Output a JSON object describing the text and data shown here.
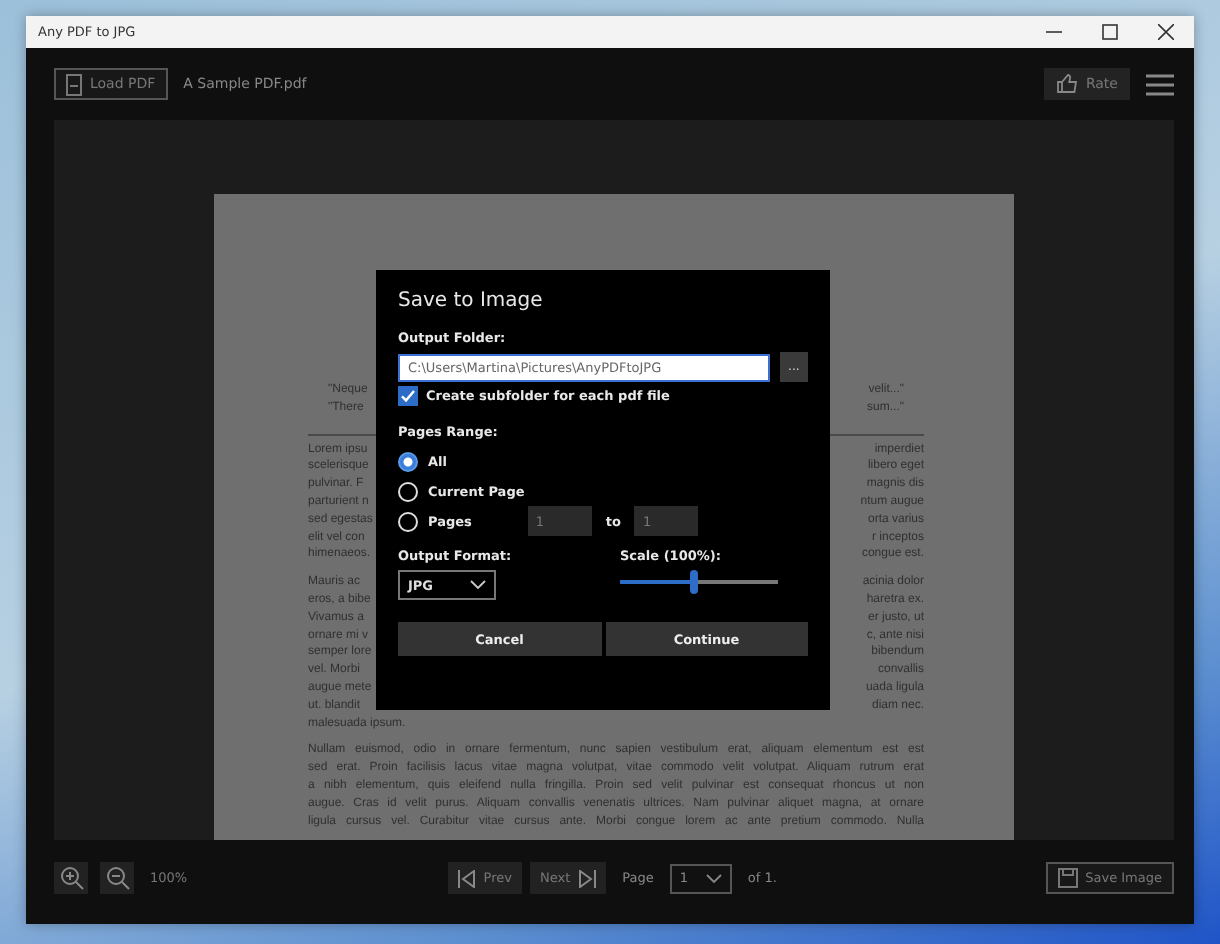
{
  "window": {
    "title": "Any PDF to JPG"
  },
  "toolbar": {
    "load_button": "Load PDF",
    "file_name": "A Sample PDF.pdf",
    "rate_button": "Rate"
  },
  "document": {
    "quotes": [
      {
        "left": "\"Neque",
        "right": "velit...\""
      },
      {
        "left": "\"There",
        "right": "sum...\""
      }
    ],
    "paragraphs": [
      {
        "lines": [
          {
            "kind": "split",
            "left": "Lorem ipsu",
            "right": "imperdiet"
          },
          {
            "kind": "split",
            "left": "scelerisque",
            "right": "libero eget"
          },
          {
            "kind": "split",
            "left": "pulvinar. F",
            "right": "magnis dis"
          },
          {
            "kind": "split",
            "left": "parturient n",
            "right": "ntum augue"
          },
          {
            "kind": "split",
            "left": "sed egestas",
            "right": "orta varius"
          },
          {
            "kind": "split",
            "left": "elit vel con",
            "right": "r inceptos"
          },
          {
            "kind": "split",
            "left": "himenaeos.",
            "right": "congue est."
          }
        ]
      },
      {
        "lines": [
          {
            "kind": "split",
            "left": "Mauris ac",
            "right": "acinia dolor"
          },
          {
            "kind": "split",
            "left": "eros, a bibe",
            "right": "haretra ex."
          },
          {
            "kind": "split",
            "left": "Vivamus a",
            "right": "er justo, ut"
          },
          {
            "kind": "split",
            "left": "ornare mi v",
            "right": "c, ante nisi"
          },
          {
            "kind": "split",
            "left": "semper lore",
            "right": "bibendum"
          },
          {
            "kind": "split",
            "left": "vel. Morbi",
            "right": "convallis"
          },
          {
            "kind": "split",
            "left": "augue mete",
            "right": "uada ligula"
          },
          {
            "kind": "split",
            "left": "ut. blandit",
            "right": "diam nec."
          },
          {
            "kind": "end",
            "full": "malesuada ipsum."
          }
        ]
      },
      {
        "lines": [
          {
            "kind": "full",
            "full": "Nullam euismod, odio in ornare fermentum, nunc sapien vestibulum erat, aliquam elementum est est"
          },
          {
            "kind": "full",
            "full": "sed erat. Proin facilisis lacus vitae magna volutpat, vitae commodo velit volutpat. Aliquam rutrum erat"
          },
          {
            "kind": "full",
            "full": "a nibh elementum, quis eleifend nulla fringilla. Proin sed velit pulvinar est consequat rhoncus ut non"
          },
          {
            "kind": "full",
            "full": "augue. Cras id velit purus. Aliquam convallis venenatis ultrices. Nam pulvinar aliquet magna, at ornare"
          },
          {
            "kind": "full",
            "full": "ligula cursus vel. Curabitur vitae cursus ante. Morbi congue lorem ac ante pretium commodo. Nulla"
          }
        ]
      }
    ]
  },
  "dialog": {
    "title": "Save to Image",
    "output_folder_label": "Output Folder:",
    "output_folder": "C:\\Users\\Martina\\Pictures\\AnyPDFtoJPG",
    "browse_button": "...",
    "subfolder_checkbox": {
      "label": "Create subfolder for each pdf file",
      "checked": true
    },
    "pages_range_label": "Pages Range:",
    "range_options": [
      {
        "label": "All",
        "selected": true
      },
      {
        "label": "Current Page",
        "selected": false
      },
      {
        "label": "Pages",
        "selected": false
      }
    ],
    "from_page": "1",
    "to_label": "to",
    "to_page": "1",
    "output_format_label": "Output Format:",
    "output_format": "JPG",
    "scale_label": "Scale (100%):",
    "scale": {
      "level": 0.47
    },
    "buttons": [
      "Cancel",
      "Continue"
    ]
  },
  "bottom_bar": {
    "zoom": "100%",
    "prev_button": "Prev",
    "next_button": "Next",
    "page_label": "Page",
    "page_value": "1",
    "page_count": "of 1.",
    "save_button": "Save Image"
  }
}
